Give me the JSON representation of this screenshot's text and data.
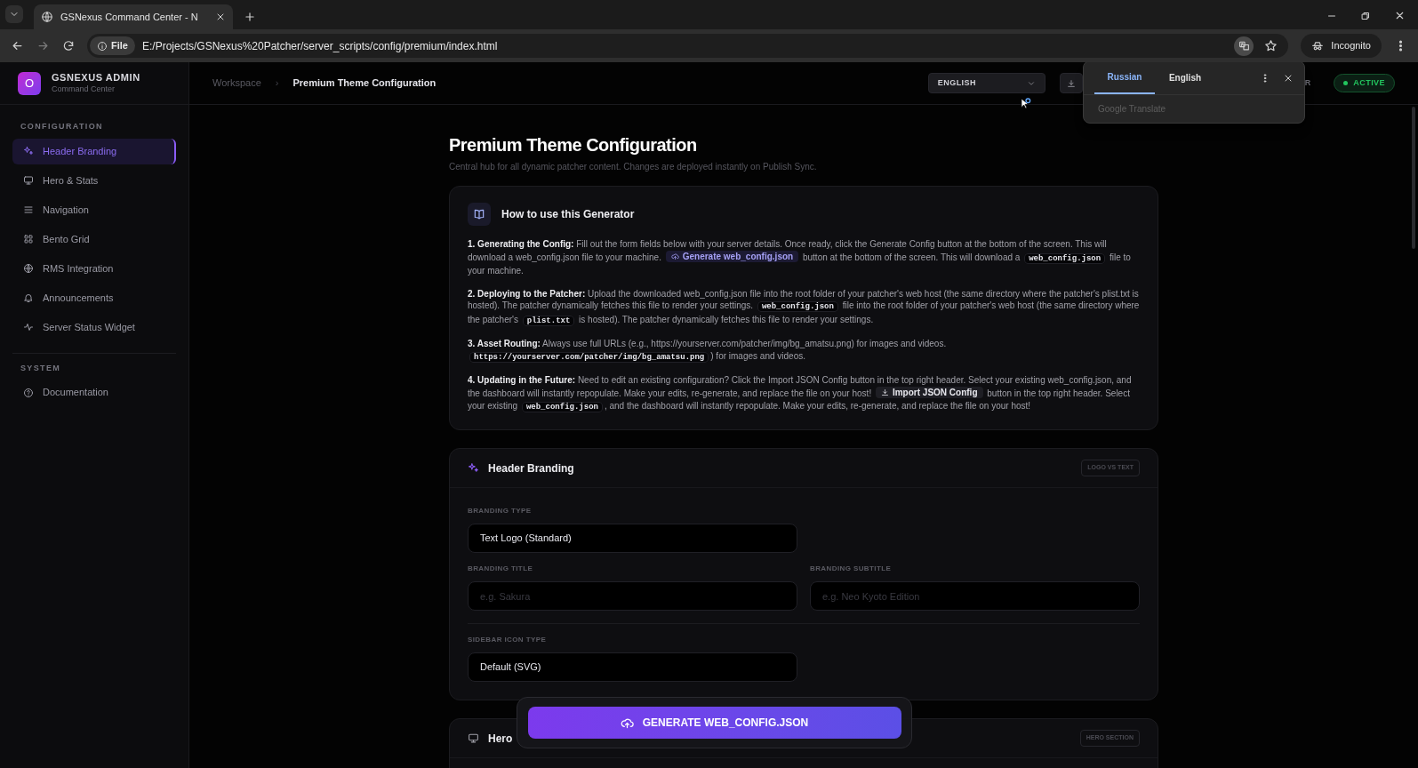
{
  "browser": {
    "tab_title": "GSNexus Command Center - N",
    "address_scheme": "File",
    "url": "E:/Projects/GSNexus%20Patcher/server_scripts/config/premium/index.html",
    "profile": "Incognito"
  },
  "sidebar": {
    "brand": "GSNEXUS ADMIN",
    "brand_subtitle": "Command Center",
    "logo_letter": "O",
    "sections": [
      {
        "title": "CONFIGURATION",
        "items": [
          {
            "label": "Header Branding",
            "selected": true
          },
          {
            "label": "Hero & Stats",
            "selected": false
          },
          {
            "label": "Navigation",
            "selected": false
          },
          {
            "label": "Bento Grid",
            "selected": false
          },
          {
            "label": "RMS Integration",
            "selected": false
          },
          {
            "label": "Announcements",
            "selected": false
          },
          {
            "label": "Server Status Widget",
            "selected": false
          }
        ]
      },
      {
        "title": "SYSTEM",
        "items": [
          {
            "label": "Documentation",
            "selected": false
          }
        ]
      }
    ]
  },
  "header": {
    "breadcrumbs": [
      "Workspace",
      "Premium Theme Configuration"
    ],
    "breadcrumb_separator": "›",
    "language": "ENGLISH",
    "partial_button_text": "R",
    "status": "ACTIVE"
  },
  "translate_popup": {
    "tabs": [
      {
        "label": "Russian",
        "selected": true
      },
      {
        "label": "English",
        "selected": false
      }
    ],
    "footer": "Google Translate"
  },
  "page": {
    "title": "Premium Theme Configuration",
    "subtitle": "Central hub for all dynamic patcher content. Changes are deployed instantly on Publish Sync."
  },
  "guide": {
    "title": "How to use this Generator",
    "steps": [
      [
        {
          "kind": "text",
          "text": "**1. Generating the Config:** Fill out the form fields below with your server details. Once ready, click the Generate Config button at the bottom of the screen. This will download a web_config.json file to your machine. "
        },
        {
          "kind": "cloud_button",
          "text": "Generate web_config.json"
        },
        {
          "kind": "text",
          "text": " button at the bottom of the screen. This will download a "
        },
        {
          "kind": "code",
          "text": "web_config.json"
        },
        {
          "kind": "text",
          "text": " file to your machine."
        }
      ],
      [
        {
          "kind": "text",
          "text": "**2. Deploying to the Patcher:** Upload the downloaded web_config.json file into the root folder of your patcher's web host (the same directory where the patcher's plist.txt is hosted). The patcher dynamically fetches this file to render your settings. "
        },
        {
          "kind": "code",
          "text": "web_config.json"
        },
        {
          "kind": "text",
          "text": " file into the root folder of your patcher's web host (the same directory where the patcher's "
        },
        {
          "kind": "code",
          "text": "plist.txt"
        },
        {
          "kind": "text",
          "text": " is hosted). The patcher dynamically fetches this file to render your settings."
        }
      ],
      [
        {
          "kind": "text",
          "text": "**3. Asset Routing:** Always use full URLs (e.g., https://yourserver.com/patcher/img/bg_amatsu.png) for images and videos. "
        },
        {
          "kind": "code",
          "text": "https://yourserver.com/patcher/img/bg_amatsu.png"
        },
        {
          "kind": "text",
          "text": ") for images and videos."
        }
      ],
      [
        {
          "kind": "text",
          "text": "**4. Updating in the Future:** Need to edit an existing configuration? Click the Import JSON Config button in the top right header. Select your existing web_config.json, and the dashboard will instantly repopulate. Make your edits, re-generate, and replace the file on your host! "
        },
        {
          "kind": "download_button",
          "text": "Import JSON Config"
        },
        {
          "kind": "text",
          "text": " button in the top right header. Select your existing "
        },
        {
          "kind": "code",
          "text": "web_config.json"
        },
        {
          "kind": "text",
          "text": ", and the dashboard will instantly repopulate. Make your edits, re-generate, and replace the file on your host!"
        }
      ]
    ]
  },
  "sections": [
    {
      "title": "Header Branding",
      "badge": "LOGO VS TEXT",
      "fields": [
        {
          "kind": "select",
          "label": "BRANDING TYPE",
          "value": "Text Logo (Standard)"
        },
        {
          "kind": "spacer"
        },
        {
          "kind": "input",
          "label": "BRANDING TITLE",
          "placeholder": "e.g. Sakura"
        },
        {
          "kind": "input",
          "label": "BRANDING SUBTITLE",
          "placeholder": "e.g. Neo Kyoto Edition"
        },
        {
          "kind": "divider"
        },
        {
          "kind": "select",
          "label": "SIDEBAR ICON TYPE",
          "value": "Default (SVG)"
        }
      ]
    },
    {
      "title": "Hero",
      "badge": "HERO SECTION"
    }
  ],
  "generate_button": "GENERATE WEB_CONFIG.JSON"
}
